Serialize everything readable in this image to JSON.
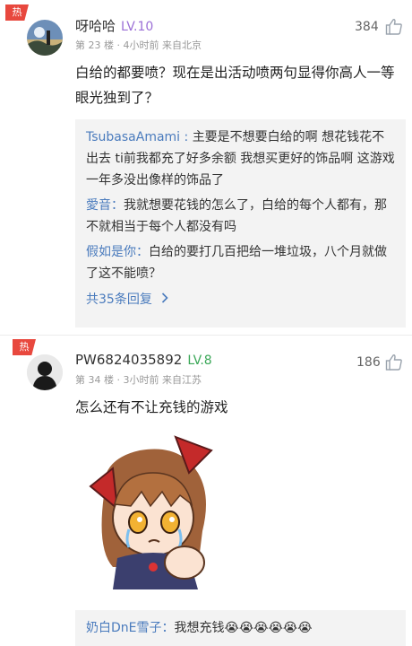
{
  "comments": [
    {
      "badge": "热",
      "username": "呀哈哈",
      "level": "LV.10",
      "level_color": "#9b6fd6",
      "meta": "第 23 楼 · 4小时前  来自北京",
      "likes": "384",
      "text": "白给的都要喷？现在是出活动喷两句显得你高人一等眼光独到了？",
      "replies": [
        {
          "name": "TsubasaAmami",
          "text": "主要是不想要白给的啊 想花钱花不出去 ti前我都充了好多余额 我想买更好的饰品啊 这游戏一年多没出像样的饰品了"
        },
        {
          "name": "愛音",
          "text": "我就想要花钱的怎么了，白给的每个人都有，那不就相当于每个人都没有吗"
        },
        {
          "name": "假如是你",
          "text": "白给的要打几百把给一堆垃圾，八个月就做了这不能喷？"
        }
      ],
      "more_replies": "共35条回复",
      "more_icon": "chevron-right-icon"
    },
    {
      "badge": "热",
      "username": "PW6824035892",
      "level": "LV.8",
      "level_color": "#3aa757",
      "meta": "第 34 楼 · 3小时前  来自江苏",
      "likes": "186",
      "text": "怎么还有不让充钱的游戏",
      "sticker": "crying-anime-girl-sticker",
      "replies": [
        {
          "name": "奶白DnE雪子",
          "text": "我想充钱😭😭😭😭😭😭"
        }
      ]
    }
  ],
  "colors": {
    "hot_badge": "#e8483e",
    "reply_name": "#4a7bbd",
    "reply_bg": "#f3f3f3"
  }
}
